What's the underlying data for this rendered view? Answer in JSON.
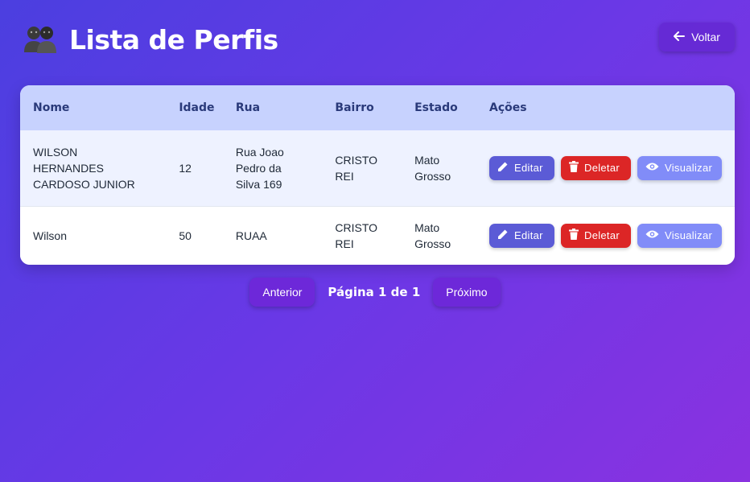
{
  "header": {
    "title": "Lista de Perfis",
    "title_icon": "users-icon",
    "back_label": "Voltar",
    "back_icon": "arrow-left-icon"
  },
  "table": {
    "columns": [
      "Nome",
      "Idade",
      "Rua",
      "Bairro",
      "Estado",
      "Ações"
    ],
    "rows": [
      {
        "nome": "WILSON HERNANDES CARDOSO JUNIOR",
        "idade": "12",
        "rua": "Rua Joao Pedro da Silva 169",
        "bairro": "CRISTO REI",
        "estado": "Mato Grosso"
      },
      {
        "nome": "Wilson",
        "idade": "50",
        "rua": "RUAA",
        "bairro": "CRISTO REI",
        "estado": "Mato Grosso"
      }
    ],
    "actions": {
      "edit_label": "Editar",
      "delete_label": "Deletar",
      "view_label": "Visualizar",
      "edit_icon": "pencil-icon",
      "delete_icon": "trash-icon",
      "view_icon": "eye-icon"
    }
  },
  "pagination": {
    "prev_label": "Anterior",
    "info": "Página 1 de 1",
    "next_label": "Próximo"
  },
  "colors": {
    "edit": "#5b5bd6",
    "delete": "#dc2626",
    "view": "#818cf8",
    "header_row": "#c7d2fe"
  }
}
